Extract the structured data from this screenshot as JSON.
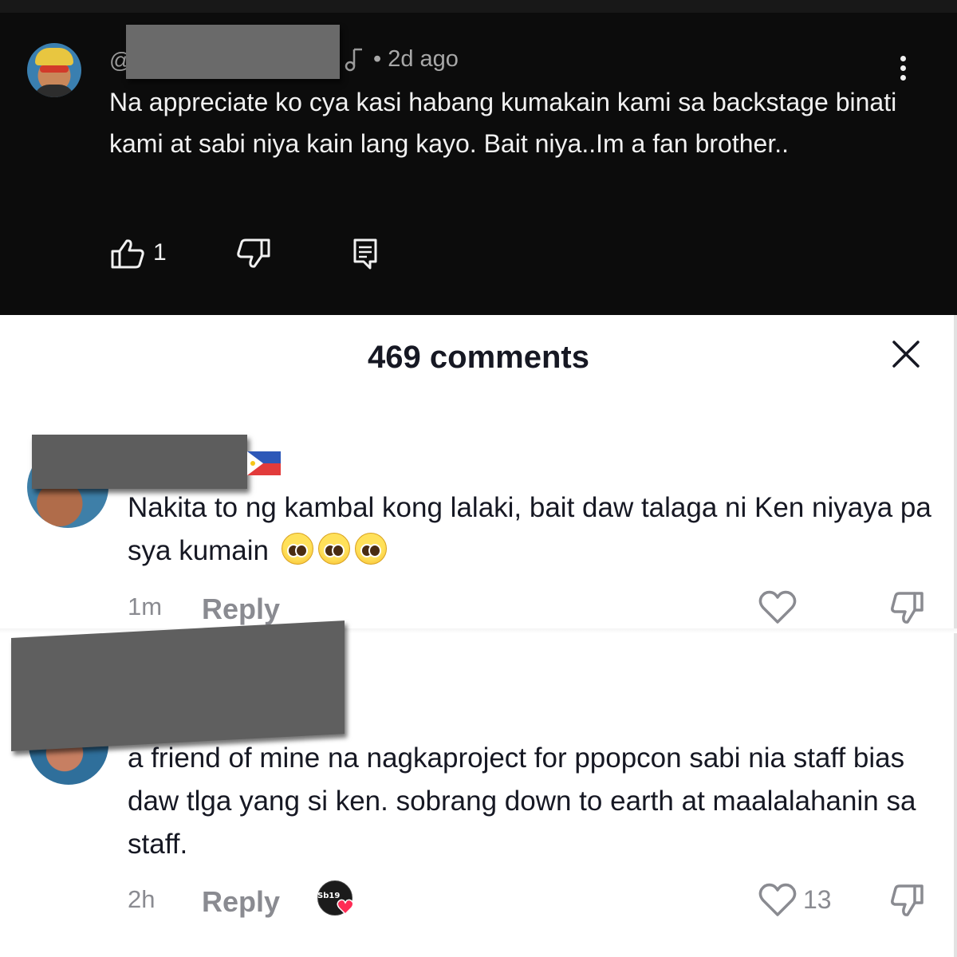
{
  "youtube_comment": {
    "handle_prefix": "@",
    "meta": "• 2d ago",
    "text": "Na appreciate ko cya kasi habang kumakain kami sa backstage binati kami at sabi niya kain lang kayo. Bait niya..Im a fan brother..",
    "like_count": "1",
    "icons": [
      "music-note-icon",
      "kebab-menu-icon",
      "thumbs-up-icon",
      "thumbs-down-icon",
      "reply-comment-icon"
    ]
  },
  "comments_sheet": {
    "title": "469 comments",
    "comments": [
      {
        "text": "Nakita to ng kambal kong lalaki, bait daw talaga ni Ken niyaya pa sya kumain",
        "emoji": "pleading-face x3",
        "time": "1m",
        "reply_label": "Reply",
        "flag": "philippines-flag-icon"
      },
      {
        "text": "a friend of mine na nagkaproject for ppopcon sabi nia staff bias daw tlga yang si ken. sobrang down to earth at maalalahanin sa staff.",
        "time": "2h",
        "reply_label": "Reply",
        "creator_tag": "Sb19",
        "like_count": "13"
      }
    ]
  },
  "colors": {
    "dark_bg": "#0c0c0c",
    "dark_text": "#f1f1f1",
    "muted": "#8a8b91",
    "heart_pink": "#fe2c55"
  }
}
